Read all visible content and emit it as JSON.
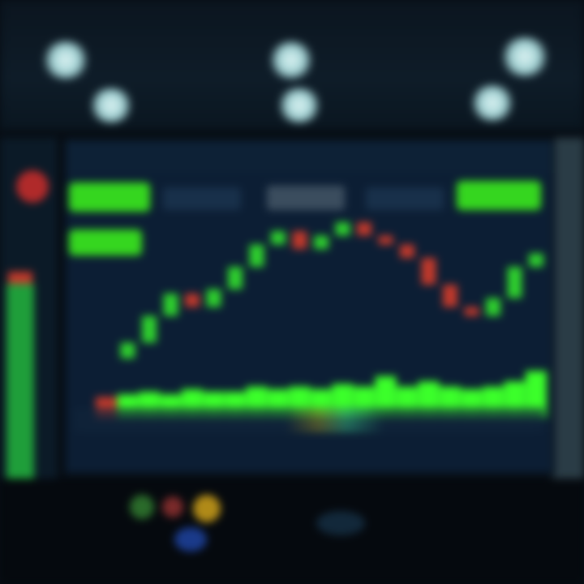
{
  "header": {
    "title_left": "",
    "title_mid": "",
    "title_right": ""
  },
  "controls": {
    "buy_left": "",
    "buy_right": "",
    "period": "",
    "tab_a": "",
    "tab_b": "",
    "mode": ""
  },
  "chart_data": {
    "type": "line",
    "x": [
      0,
      1,
      2,
      3,
      4,
      5,
      6,
      7,
      8,
      9,
      10,
      11,
      12,
      13,
      14,
      15,
      16,
      17,
      18,
      19,
      20
    ],
    "series": [
      {
        "values": [
          15,
          22,
          34,
          44,
          38,
          46,
          56,
          66,
          72,
          64,
          70,
          76,
          70,
          66,
          60,
          48,
          38,
          34,
          42,
          56,
          62
        ]
      },
      {
        "values": [
          8,
          9,
          10,
          9,
          11,
          10,
          10,
          12,
          11,
          12,
          11,
          13,
          12,
          16,
          12,
          14,
          12,
          11,
          12,
          14,
          18
        ]
      }
    ],
    "colors": {
      "up": "#2ecf2e",
      "down": "#c0392b",
      "bar": "#3bff2a",
      "bg": "#0c1e34"
    }
  },
  "colors": {
    "accent": "#35d61f",
    "down": "#c0392b",
    "background": "#070d14"
  }
}
